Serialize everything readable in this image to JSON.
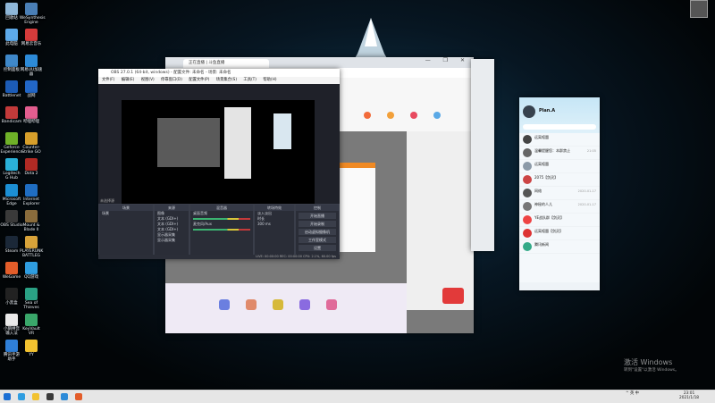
{
  "desktop": {
    "icons": [
      {
        "label": "回收站",
        "color": "#8fb7d8"
      },
      {
        "label": "WeSynthesis\nEngine",
        "color": "#4a7fb6"
      },
      {
        "label": "此电脑",
        "color": "#5da9e9"
      },
      {
        "label": "网易云音乐",
        "color": "#d53b3b"
      },
      {
        "label": "控制面板",
        "color": "#3f88c9"
      },
      {
        "label": "网易UU加速器",
        "color": "#2d8bd8"
      },
      {
        "label": "Battlenet",
        "color": "#1c5bb5"
      },
      {
        "label": "战网",
        "color": "#2267c7"
      },
      {
        "label": "Bandicam",
        "color": "#c23a3a"
      },
      {
        "label": "哔哩哔哩",
        "color": "#e25d8f"
      },
      {
        "label": "Geforce\nExperience",
        "color": "#6fb128"
      },
      {
        "label": "Counter-\nStrike GO",
        "color": "#d79f2b"
      },
      {
        "label": "Logitech\nG Hub",
        "color": "#2ab0d8"
      },
      {
        "label": "Dota 2",
        "color": "#b02a24"
      },
      {
        "label": "Microsoft\nEdge",
        "color": "#1c8fd4"
      },
      {
        "label": "Internet\nExplorer",
        "color": "#1f6dc2"
      },
      {
        "label": "OBS Studio",
        "color": "#3a3a3a"
      },
      {
        "label": "Mount &\nBlade II",
        "color": "#8a6c3c"
      },
      {
        "label": "Steam",
        "color": "#1b2838"
      },
      {
        "label": "PLAYERUNK\nBATTLEG",
        "color": "#d8a33a"
      },
      {
        "label": "WeGame",
        "color": "#e35d2a"
      },
      {
        "label": "QQ游戏",
        "color": "#2f9de0"
      },
      {
        "label": "小黑盒",
        "color": "#222"
      },
      {
        "label": "Sea of\nThieves",
        "color": "#2aa184"
      },
      {
        "label": "小鹅拼音\n输入法",
        "color": "#eaeaea"
      },
      {
        "label": "KeyVault\nVR",
        "color": "#3aa76a"
      },
      {
        "label": "腾讯手游\n助手",
        "color": "#2f7fd8"
      },
      {
        "label": "YY",
        "color": "#f2c230"
      }
    ]
  },
  "browser": {
    "tab_title": "正在直播 | 斗鱼直播",
    "content_note": ""
  },
  "obs": {
    "title": "OBS 27.0.1 (64-bit, windows) - 配置文件: 未命名 - 场景: 未命名",
    "menu": "文件(F) 编辑(E) 视图(V) 停靠窗口(D) 配置文件(P) 场景集合(S) 工具(T) 帮助(H)",
    "status": "未选择源",
    "panels": {
      "scenes": {
        "title": "场景",
        "items": [
          "场景"
        ]
      },
      "sources": {
        "title": "来源",
        "items": [
          "图像",
          "文本 (GDI+)",
          "文本 (GDI+)",
          "文本 (GDI+)",
          "显示器采集",
          "显示器采集"
        ]
      },
      "mixer": {
        "title": "混音器",
        "items": [
          "桌面音频",
          "麦克风/Aux"
        ]
      },
      "transitions": {
        "title": "转场特效",
        "items": [
          "淡入淡出",
          "时长",
          "300 ms"
        ]
      },
      "controls": {
        "title": "控制",
        "buttons": [
          "开始直播",
          "开始录制",
          "启动虚拟摄像机",
          "工作室模式",
          "设置",
          "退出"
        ]
      }
    },
    "statusbar": "LIVE: 00:00:00  REC: 00:00:00  CPU: 2.1%, 60.00 fps"
  },
  "qq": {
    "name": "Plan.A",
    "contacts": [
      {
        "name": "远离喧嚣",
        "msg": "",
        "time": "",
        "color": "#444"
      },
      {
        "name": "温馨提醒您：本群禁止",
        "msg": "",
        "time": "21:05",
        "color": "#666"
      },
      {
        "name": "远离喧嚣",
        "msg": "",
        "time": "",
        "color": "#8c9aa8"
      },
      {
        "name": "2075【剑灵】",
        "msg": "",
        "time": "",
        "color": "#c44"
      },
      {
        "name": "网络",
        "msg": "",
        "time": "2020-01-17",
        "color": "#555"
      },
      {
        "name": "神秘的人儿",
        "msg": "",
        "time": "2020-01-17",
        "color": "#777"
      },
      {
        "name": "YE战队群【剑灵】",
        "msg": "",
        "time": "",
        "color": "#e44"
      },
      {
        "name": "远离喧嚣【剑灵】",
        "msg": "",
        "time": "",
        "color": "#d33"
      },
      {
        "name": "腾讯新闻",
        "msg": "",
        "time": "",
        "color": "#3a8"
      }
    ]
  },
  "watermark": {
    "title": "激活 Windows",
    "sub": "转到\"设置\"以激活 Windows。"
  },
  "taskbar": {
    "time": "23:01",
    "date": "2021/1/18",
    "tray_text": "^ 英 中"
  }
}
